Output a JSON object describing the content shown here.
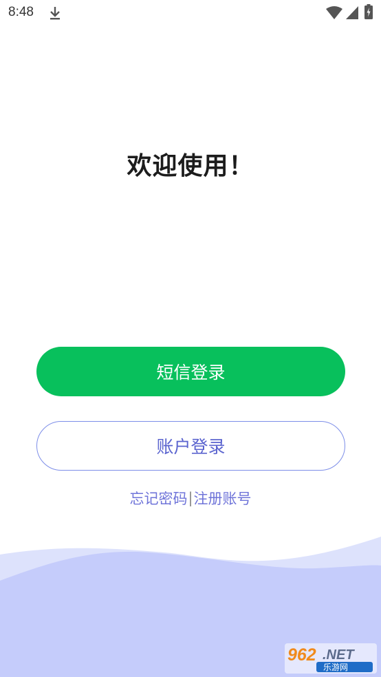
{
  "status_bar": {
    "time": "8:48",
    "icons": [
      "download-icon",
      "wifi-icon",
      "signal-icon",
      "battery-icon"
    ]
  },
  "welcome": {
    "title": "欢迎使用！"
  },
  "buttons": {
    "sms_login": "短信登录",
    "account_login": "账户登录"
  },
  "links": {
    "forgot_password": "忘记密码",
    "separator": "|",
    "register_account": "注册账号"
  },
  "watermark": {
    "brand": "962.NET",
    "subtitle": "乐游网"
  },
  "colors": {
    "primary_green": "#08c05c",
    "accent_blue": "#6f74d9",
    "wave_blue": "#c5ccfb",
    "wave_light": "#dde2fc"
  }
}
